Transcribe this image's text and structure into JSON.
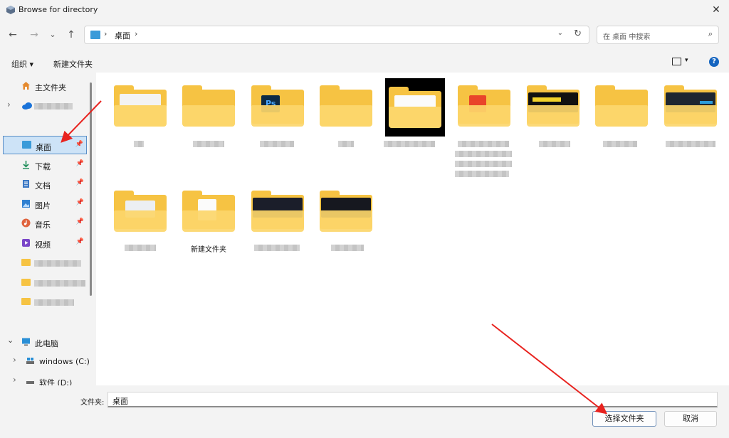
{
  "window": {
    "title": "Browse for directory",
    "close_glyph": "✕"
  },
  "nav": {
    "back": "←",
    "forward": "→",
    "recent": "⌄",
    "up": "↑"
  },
  "address": {
    "location": "桌面",
    "chevron": "›",
    "dropdown": "⌄",
    "refresh": "↻"
  },
  "search": {
    "placeholder": "在 桌面 中搜索",
    "icon": "⌕"
  },
  "toolbar": {
    "organize": "组织 ▾",
    "new_folder": "新建文件夹",
    "view_chevron": "▾",
    "help": "?"
  },
  "sidebar": {
    "items": [
      {
        "label": "主文件夹",
        "icon": "home-icon"
      },
      {
        "label": "",
        "icon": "cloud-icon"
      },
      {
        "label": "桌面",
        "icon": "desktop-icon",
        "pinned": true
      },
      {
        "label": "下载",
        "icon": "download-icon",
        "pinned": true
      },
      {
        "label": "文档",
        "icon": "document-icon",
        "pinned": true
      },
      {
        "label": "图片",
        "icon": "pictures-icon",
        "pinned": true
      },
      {
        "label": "音乐",
        "icon": "music-icon",
        "pinned": true
      },
      {
        "label": "视频",
        "icon": "video-icon",
        "pinned": true
      },
      {
        "label": "此电脑",
        "icon": "pc-icon"
      },
      {
        "label": "windows (C:)",
        "icon": "drive-c-icon"
      },
      {
        "label": "软件 (D:)",
        "icon": "drive-d-icon"
      }
    ],
    "pin_glyph": "📌",
    "expand_glyph": "›",
    "collapse_glyph": "⌄"
  },
  "folders": [
    {
      "label": ""
    },
    {
      "label": ""
    },
    {
      "label": ""
    },
    {
      "label": ""
    },
    {
      "label": ""
    },
    {
      "label": ""
    },
    {
      "label": ""
    },
    {
      "label": ""
    },
    {
      "label": ""
    },
    {
      "label": ""
    },
    {
      "label": "新建文件夹"
    },
    {
      "label": ""
    },
    {
      "label": ""
    }
  ],
  "footer": {
    "filename_label": "文件夹:",
    "filename_value": "桌面",
    "select_button": "选择文件夹",
    "cancel_button": "取消"
  },
  "colors": {
    "accent": "#1565c0",
    "folder": "#f6c343",
    "annotation_arrow": "#e8231f"
  }
}
